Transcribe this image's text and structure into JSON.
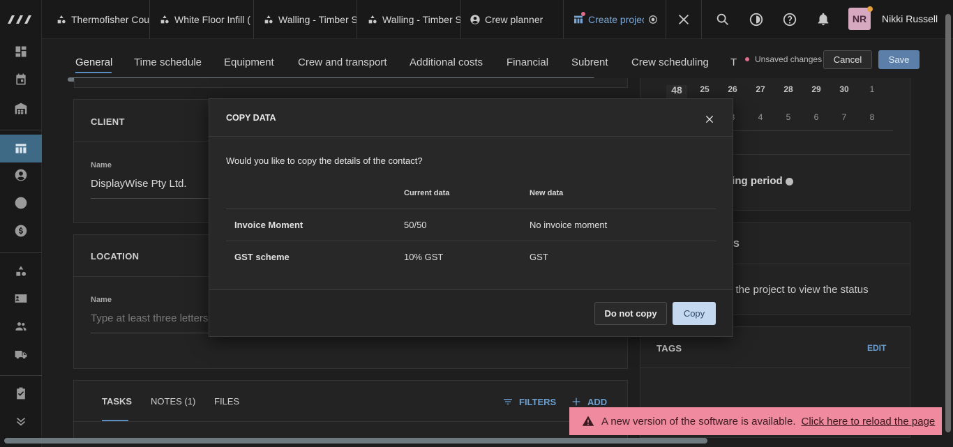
{
  "topbar": {
    "tabs": [
      {
        "label": "Thermofisher Cou",
        "icon": "shapes-icon"
      },
      {
        "label": "White Floor Infill (",
        "icon": "shapes-icon"
      },
      {
        "label": "Walling - Timber S",
        "icon": "shapes-icon"
      },
      {
        "label": "Walling - Timber S",
        "icon": "shapes-icon"
      },
      {
        "label": "Crew planner",
        "icon": "user-circle-icon"
      },
      {
        "label": "Create projec",
        "icon": "add-project-icon"
      }
    ],
    "user_initials": "NR",
    "user_name": "Nikki Russell"
  },
  "subtabs": {
    "items": [
      "General",
      "Time schedule",
      "Equipment",
      "Crew and transport",
      "Additional costs",
      "Financial",
      "Subrent",
      "Crew scheduling",
      "T"
    ],
    "active": "General",
    "unsaved_label": "Unsaved changes",
    "cancel_label": "Cancel",
    "save_label": "Save"
  },
  "client_card": {
    "heading": "CLIENT",
    "name_label": "Name",
    "name_value": "DisplayWise Pty Ltd."
  },
  "location_card": {
    "heading": "LOCATION",
    "name_label": "Name",
    "name_placeholder": "Type at least three letters"
  },
  "tasks_card": {
    "tabs": [
      "TASKS",
      "NOTES (1)",
      "FILES"
    ],
    "filters_label": "FILTERS",
    "add_label": "ADD"
  },
  "calendar": {
    "week": "48",
    "row1": [
      "25",
      "26",
      "27",
      "28",
      "29",
      "30",
      "1"
    ],
    "row2": [
      "3",
      "4",
      "5",
      "6",
      "7",
      "8"
    ]
  },
  "right_panel": {
    "period_text": "ning period",
    "status_heading": "SS",
    "status_text": "e the project to view the status",
    "tags_heading": "TAGS",
    "tags_edit": "EDIT"
  },
  "modal": {
    "title": "COPY DATA",
    "question": "Would you like to copy the details of the contact?",
    "col_current": "Current data",
    "col_new": "New data",
    "rows": [
      {
        "field": "Invoice Moment",
        "current": "50/50",
        "new": "No invoice moment"
      },
      {
        "field": "GST scheme",
        "current": "10% GST",
        "new": "GST"
      }
    ],
    "no_copy_label": "Do not copy",
    "copy_label": "Copy"
  },
  "toast": {
    "message": "A new version of the software is available.",
    "link": "Click here to reload the page"
  },
  "colors": {
    "accent": "#5b8fc1",
    "save_button": "#5b7fa8",
    "copy_button": "#c4d8ef",
    "toast": "#f08a9e",
    "avatar": "#d6a9c0"
  }
}
